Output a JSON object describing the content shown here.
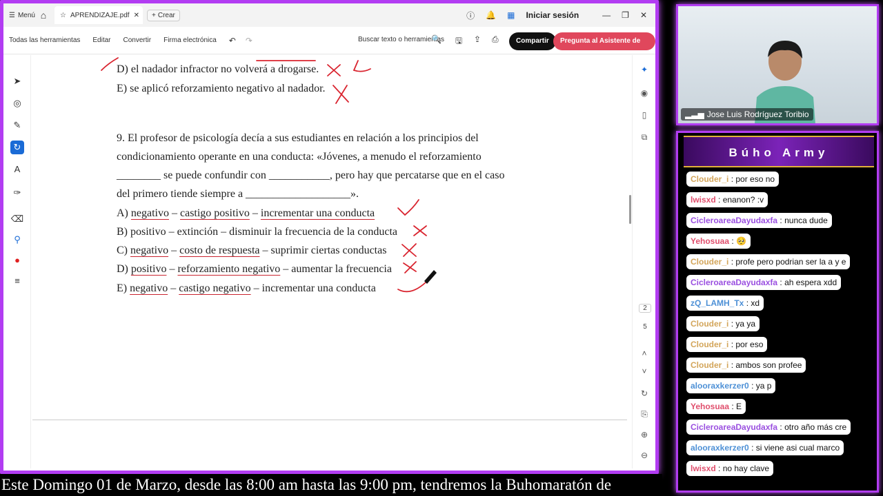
{
  "titlebar": {
    "menu_label": "Menú",
    "tab_name": "APRENDIZAJE.pdf",
    "create_label": "Crear",
    "login_label": "Iniciar sesión"
  },
  "toolbar": {
    "all_tools": "Todas las herramientas",
    "edit": "Editar",
    "convert": "Convertir",
    "esign": "Firma electrónica",
    "search_placeholder": "Buscar texto o herramientas",
    "share": "Compartir",
    "ai_assistant": "Pregunta al Asistente de IA"
  },
  "document": {
    "prev_d": "D) el nadador infractor no volverá a drogarse.",
    "prev_e": "E) se aplicó reforzamiento negativo al nadador.",
    "q9_line1": "9. El profesor de psicología decía a sus estudiantes en relación a los principios del",
    "q9_line2": "condicionamiento operante en una conducta: «Jóvenes, a menudo el reforzamiento",
    "q9_line3": "________ se puede confundir con ___________, pero hay que percatarse que en el caso",
    "q9_line4": "del primero tiende siempre a ___________________».",
    "options": [
      {
        "prefix": "A) ",
        "a": "negativo",
        "sep1": " – ",
        "b": "castigo positivo",
        "sep2": " – ",
        "c": "incrementar una conducta"
      },
      {
        "prefix": "B) ",
        "a": "positivo",
        "sep1": " – ",
        "b": "extinción",
        "sep2": " – ",
        "c": "disminuir la frecuencia de la conducta"
      },
      {
        "prefix": "C) ",
        "a": "negativo",
        "sep1": " – ",
        "b": "costo de respuesta",
        "sep2": " – ",
        "c": "suprimir ciertas conductas"
      },
      {
        "prefix": "D) ",
        "a": "positivo",
        "sep1": " – ",
        "b": "reforzamiento negativo",
        "sep2": " – ",
        "c": "aumentar la frecuencia"
      },
      {
        "prefix": "E) ",
        "a": "negativo",
        "sep1": " – ",
        "b": "castigo negativo",
        "sep2": " – ",
        "c": "incrementar una conducta"
      }
    ]
  },
  "pages": {
    "current": "2",
    "total": "5"
  },
  "webcam": {
    "name": "Jose Luis Rodríguez Toribio"
  },
  "chat": {
    "title": "Búho Army",
    "messages": [
      {
        "user": "Clouder_i",
        "text": ": por eso no",
        "cls": "u-clouder"
      },
      {
        "user": "lwisxd",
        "text": ": enanon? :v",
        "cls": "u-lwisxd"
      },
      {
        "user": "CicleroareaDayudaxfa",
        "text": ": nunca dude",
        "cls": "u-cicle"
      },
      {
        "user": "Yehosuaa",
        "text": ": 🥺",
        "cls": "u-yeho"
      },
      {
        "user": "Clouder_i",
        "text": ": profe pero podrian ser la a y e",
        "cls": "u-clouder"
      },
      {
        "user": "CicleroareaDayudaxfa",
        "text": ": ah espera xdd",
        "cls": "u-cicle"
      },
      {
        "user": "zQ_LAMH_Tx",
        "text": ": xd",
        "cls": "u-zq"
      },
      {
        "user": "Clouder_i",
        "text": ": ya ya",
        "cls": "u-clouder"
      },
      {
        "user": "Clouder_i",
        "text": ": por eso",
        "cls": "u-clouder"
      },
      {
        "user": "Clouder_i",
        "text": ": ambos son profee",
        "cls": "u-clouder"
      },
      {
        "user": "alooraxkerzer0",
        "text": ": ya p",
        "cls": "u-aloo"
      },
      {
        "user": "Yehosuaa",
        "text": ": E",
        "cls": "u-yeho"
      },
      {
        "user": "CicleroareaDayudaxfa",
        "text": ": otro año más cre",
        "cls": "u-cicle"
      },
      {
        "user": "alooraxkerzer0",
        "text": ": si viene asi cual marco",
        "cls": "u-aloo"
      },
      {
        "user": "lwisxd",
        "text": ": no hay clave",
        "cls": "u-lwisxd"
      }
    ]
  },
  "ticker": {
    "text": "Este Domingo 01 de Marzo, desde las 8:00 am hasta las 9:00 pm, tendremos la Buhomaratón de"
  },
  "colors": {
    "frame": "#b23cf2",
    "share": "#111111",
    "ai": "#e0475c",
    "ink": "#c9232e"
  }
}
